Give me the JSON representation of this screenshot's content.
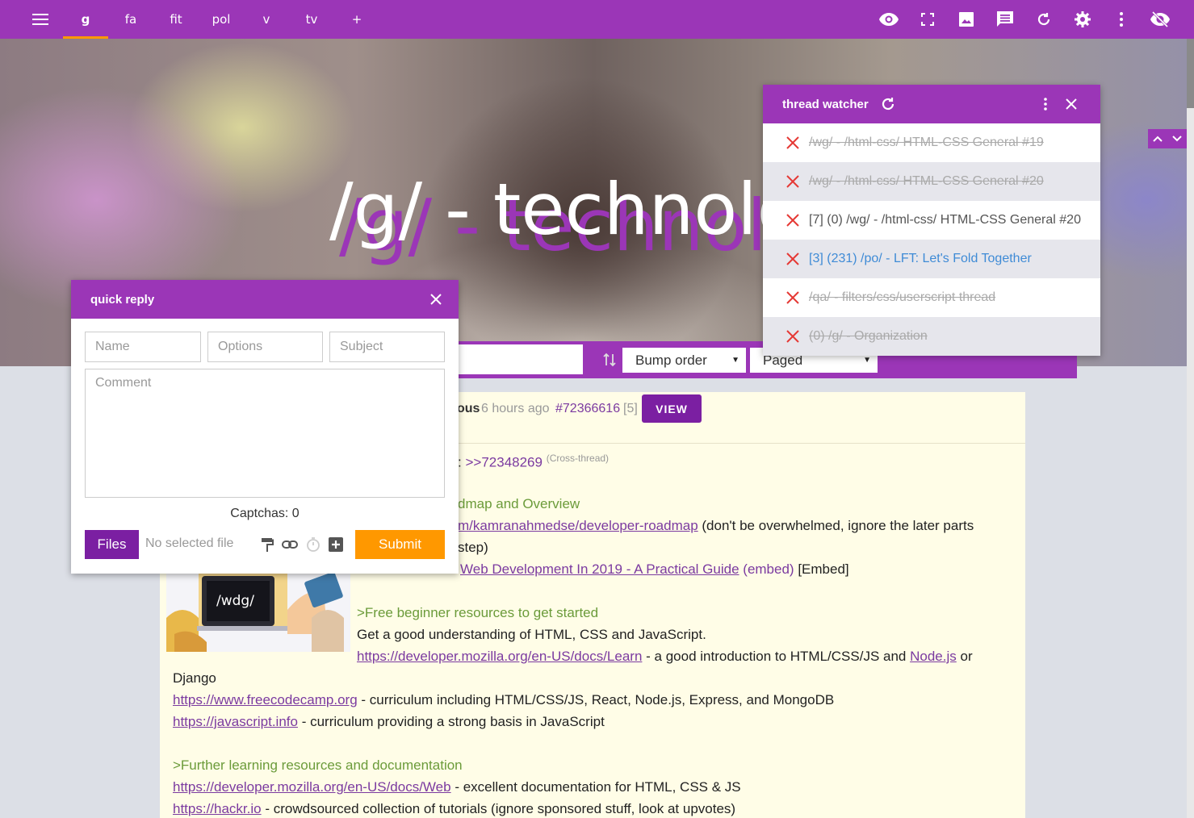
{
  "topbar": {
    "tabs": [
      "g",
      "fa",
      "fit",
      "pol",
      "v",
      "tv",
      "+"
    ],
    "active_tab": "g",
    "actions": [
      "eye-icon",
      "fullscreen-icon",
      "image-icon",
      "comment-icon",
      "refresh-icon",
      "settings-icon",
      "more-vert-icon",
      "visibility-off-icon"
    ]
  },
  "banner": {
    "title": "/g/ - technolo"
  },
  "catalog": {
    "sort_order": "Bump order",
    "view_mode": "Paged"
  },
  "thread": {
    "name_fragment": "ous",
    "time": "6 hours ago",
    "post_number": "#72366616",
    "reply_count": "[5]",
    "view_label": "VIEW",
    "lines": {
      "quote_prefix": ":",
      "quote_link": ">>72348269",
      "cross_thread": "(Cross-thread)",
      "roadmap_heading": "dmap and Overview",
      "roadmap_link": "m/kamranahmedse/developer-roadmap",
      "roadmap_text": "(don't be overwhelmed, ignore the later parts",
      "roadmap_text2": "step)",
      "video_link": "Web Development In 2019 - A Practical Guide",
      "video_embed": "(embed)",
      "video_embed_bracket": "[Embed]",
      "free_heading": ">Free beginner resources to get started",
      "free_text": "Get a good understanding of HTML, CSS and JavaScript.",
      "mdn_learn_link": "https://developer.mozilla.org/en-US/docs/Learn",
      "mdn_learn_text": "- a good introduction to HTML/CSS/JS and",
      "nodejs_link": "Node.js",
      "or_text": "or",
      "django_text": "Django",
      "fcc_link": "https://www.freecodecamp.org",
      "fcc_text": "- curriculum including HTML/CSS/JS, React, Node.js, Express, and MongoDB",
      "jsinfo_link": "https://javascript.info",
      "jsinfo_text": "- curriculum providing a strong basis in JavaScript",
      "further_heading": ">Further learning resources and documentation",
      "mdn_web_link": "https://developer.mozilla.org/en-US/docs/Web",
      "mdn_web_text": "- excellent documentation for HTML, CSS & JS",
      "hackr_link": "https://hackr.io",
      "hackr_text": "- crowdsourced collection of tutorials (ignore sponsored stuff, look at upvotes)"
    },
    "thumbnail_text": "/wdg/"
  },
  "quick_reply": {
    "title": "quick reply",
    "name_placeholder": "Name",
    "options_placeholder": "Options",
    "subject_placeholder": "Subject",
    "comment_placeholder": "Comment",
    "captchas": "Captchas: 0",
    "files_label": "Files",
    "no_file": "No selected file",
    "submit_label": "Submit"
  },
  "watcher": {
    "title": "thread watcher",
    "items": [
      {
        "text": "/wg/ - /html-css/ HTML-CSS General #19",
        "state": "dead"
      },
      {
        "text": "/wg/ - /html-css/ HTML-CSS General #20",
        "state": "dead"
      },
      {
        "text": "[7] (0) /wg/ - /html-css/ HTML-CSS General #20",
        "state": "normal"
      },
      {
        "text": "[3] (231) /po/ - LFT: Let's Fold Together",
        "state": "new"
      },
      {
        "text": "/qa/ - filters/css/userscript thread",
        "state": "dead"
      },
      {
        "text": "(0) /g/ - Organization",
        "state": "dead"
      }
    ]
  },
  "colors": {
    "accent": "#9b36b7",
    "button_purple": "#7b1fa2",
    "submit_orange": "#ff9800",
    "post_bg": "#fffde7",
    "greentext": "#6b9b3a",
    "link": "#7b3aa0",
    "new_reply_blue": "#3f8bd6"
  }
}
